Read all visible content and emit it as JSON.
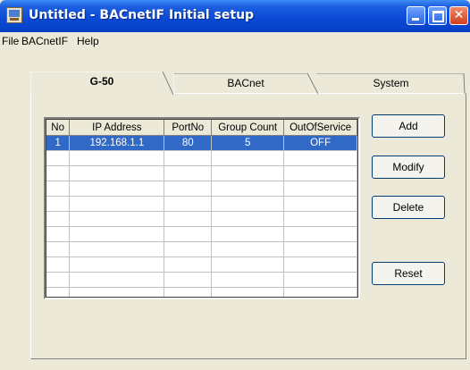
{
  "window": {
    "title": "Untitled - BACnetIF Initial setup"
  },
  "menu": {
    "file": "File",
    "bacnetif": "BACnetIF",
    "help": "Help"
  },
  "tabs": [
    {
      "label": "G-50",
      "active": true
    },
    {
      "label": "BACnet",
      "active": false
    },
    {
      "label": "System",
      "active": false
    }
  ],
  "table": {
    "headers": [
      "No",
      "IP Address",
      "PortNo",
      "Group Count",
      "OutOfService"
    ],
    "rows": [
      {
        "no": "1",
        "ip": "192.168.1.1",
        "port": "80",
        "group_count": "5",
        "out_of_service": "OFF",
        "selected": true
      }
    ],
    "empty_rows": 10
  },
  "buttons": {
    "add": "Add",
    "modify": "Modify",
    "delete": "Delete",
    "reset": "Reset"
  },
  "colors": {
    "selection": "#3169c6",
    "titlebar": "#0a49d6",
    "face": "#ece9d8"
  }
}
